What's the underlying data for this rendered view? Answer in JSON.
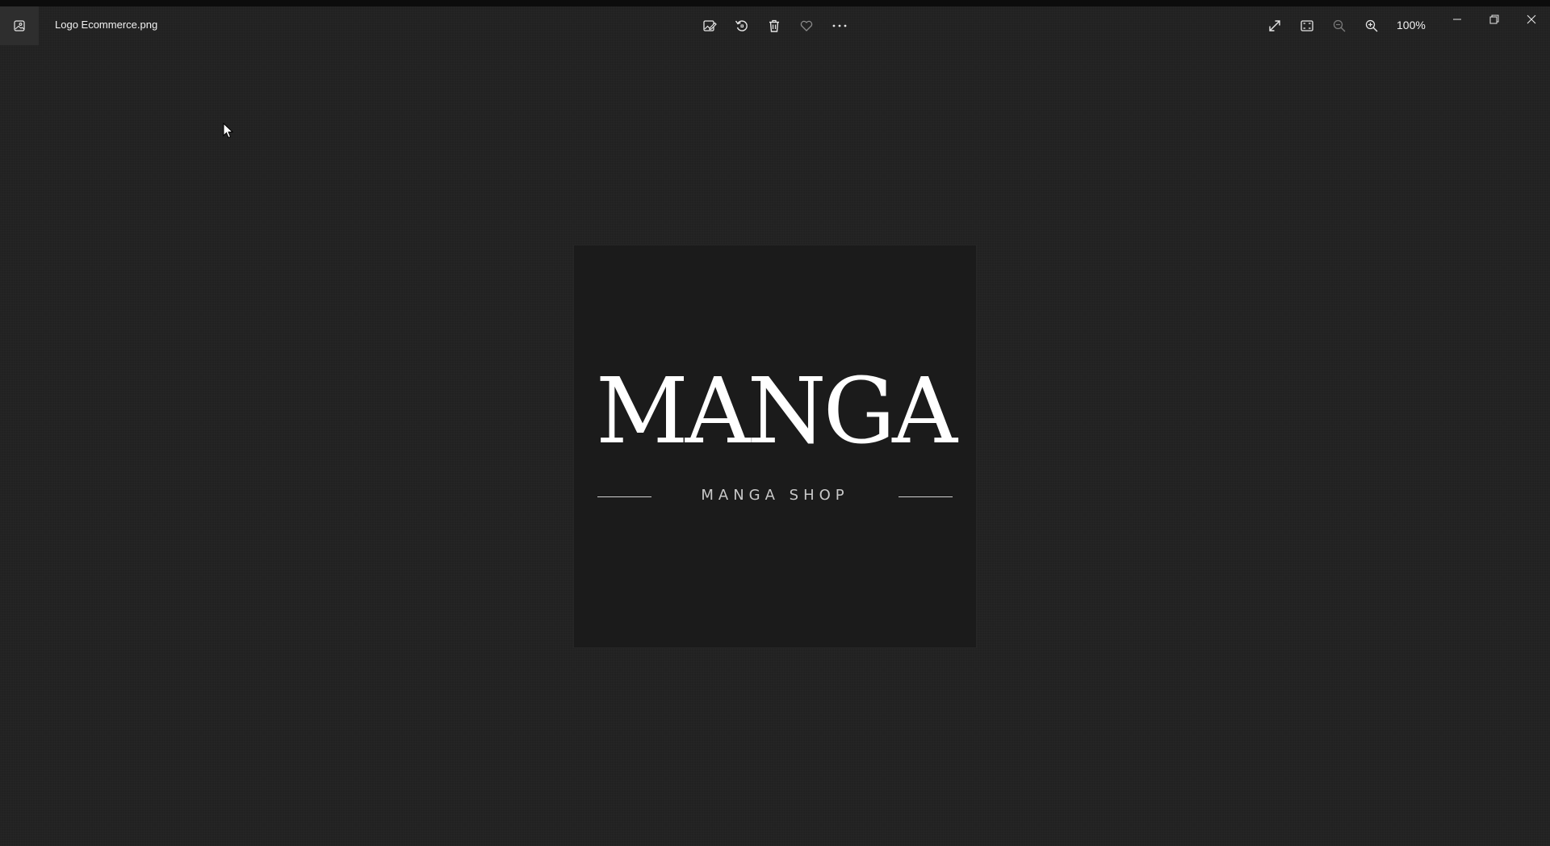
{
  "window": {
    "filename": "Logo Ecommerce.png",
    "zoom": "100%"
  },
  "toolbar": {
    "items": [
      {
        "name": "edit-image",
        "icon": "edit-image-icon"
      },
      {
        "name": "rotate",
        "icon": "rotate-icon"
      },
      {
        "name": "delete",
        "icon": "trash-icon"
      },
      {
        "name": "favorite",
        "icon": "heart-icon"
      },
      {
        "name": "more",
        "icon": "ellipsis-icon"
      }
    ],
    "right_items": [
      {
        "name": "fullscreen",
        "icon": "expand-icon"
      },
      {
        "name": "actual-size",
        "icon": "fit-screen-icon"
      },
      {
        "name": "zoom-out",
        "icon": "zoom-out-icon"
      },
      {
        "name": "zoom-in",
        "icon": "zoom-in-icon"
      }
    ]
  },
  "image": {
    "logo_word": "MANGA",
    "logo_subtitle": "MANGA SHOP"
  },
  "colors": {
    "background": "#212121",
    "image_background": "#1b1b1b",
    "icon": "#e6e6e6"
  }
}
